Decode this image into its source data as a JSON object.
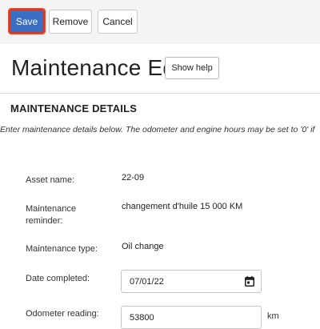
{
  "toolbar": {
    "save_label": "Save",
    "remove_label": "Remove",
    "cancel_label": "Cancel",
    "save_color": "#3a6fc4",
    "save_highlight_color": "#d23a2a"
  },
  "page": {
    "title": "Maintenance Edit",
    "help_label": "Show help"
  },
  "section": {
    "title": "MAINTENANCE DETAILS",
    "description": "Enter maintenance details below. The odometer and engine hours may be set to '0' if"
  },
  "fields": {
    "asset_name": {
      "label": "Asset name:",
      "value": "22-09"
    },
    "maintenance_reminder": {
      "label_line1": "Maintenance",
      "label_line2": "reminder:",
      "value": "changement d'huile 15 000 KM"
    },
    "maintenance_type": {
      "label": "Maintenance type:",
      "value": "Oil change"
    },
    "date_completed": {
      "label": "Date completed:",
      "value": "07/01/22",
      "icon": "calendar-icon"
    },
    "odometer_reading": {
      "label": "Odometer reading:",
      "value": "53800",
      "unit": "km"
    }
  }
}
